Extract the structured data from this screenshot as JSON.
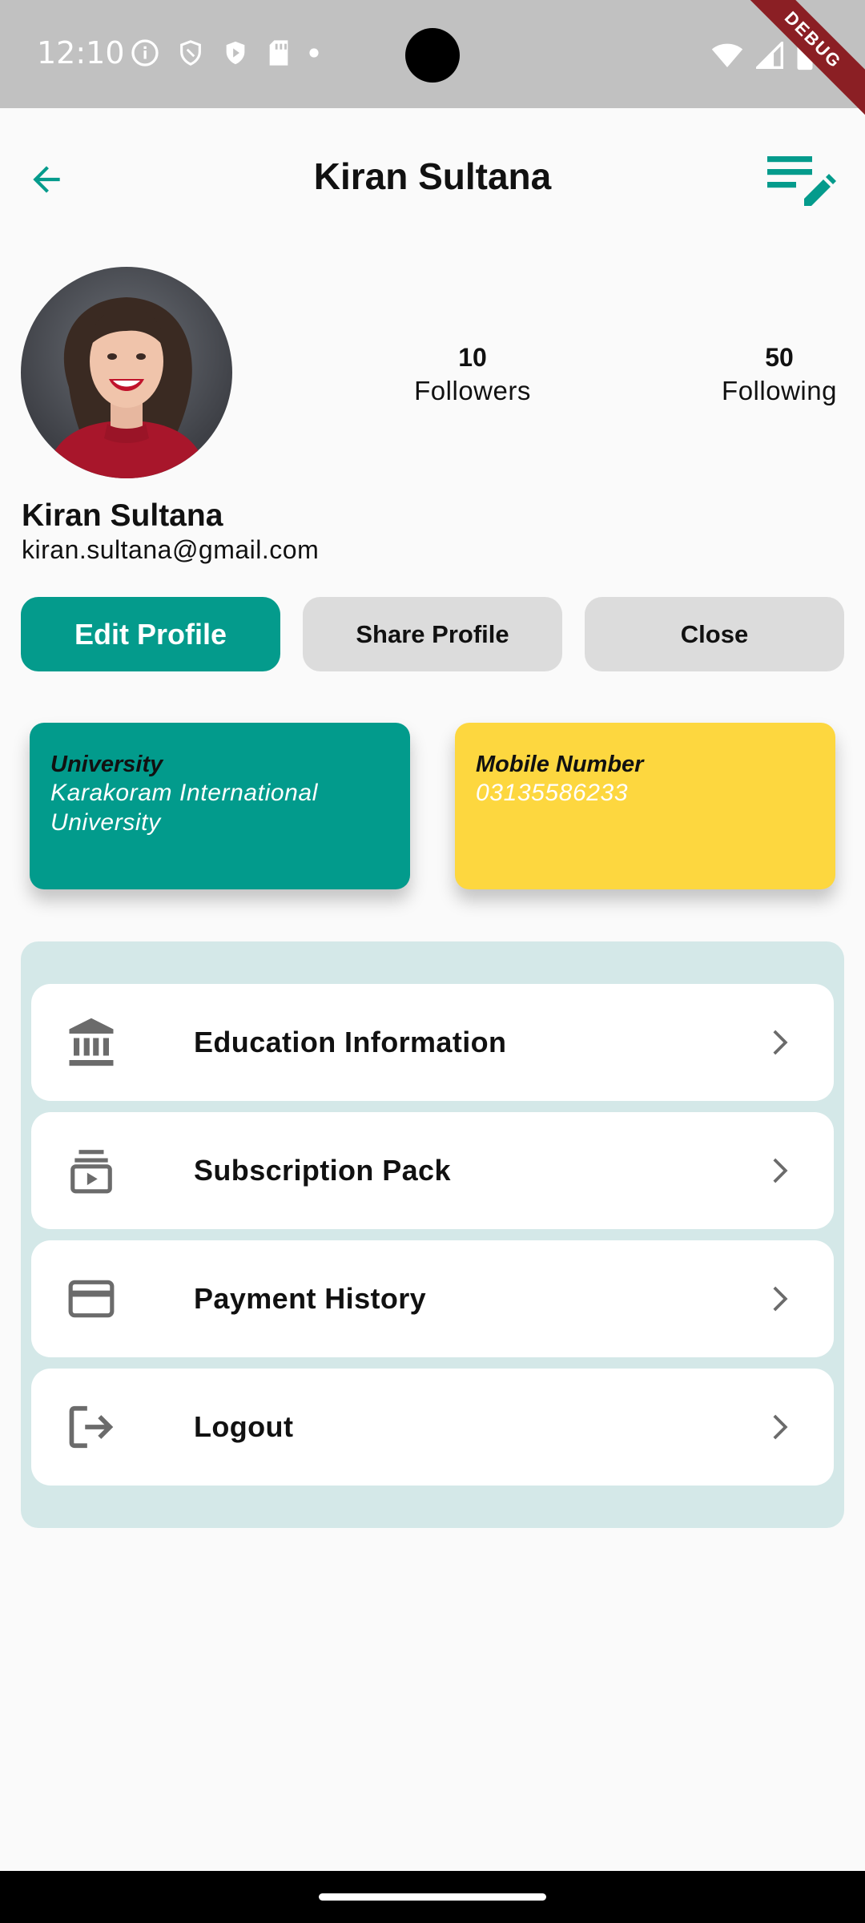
{
  "status_bar": {
    "time": "12:10",
    "debug_label": "DEBUG",
    "icons_left": [
      "info-icon",
      "shield-icon",
      "play-shield-icon",
      "sd-card-icon",
      "dot-icon"
    ],
    "icons_right": [
      "wifi-icon",
      "signal-icon",
      "battery-icon"
    ]
  },
  "app_bar": {
    "title": "Kiran Sultana",
    "back_icon": "arrow-back-icon",
    "action_icon": "edit-list-icon",
    "accent": "#049b8c"
  },
  "profile": {
    "name": "Kiran Sultana",
    "email": "kiran.sultana@gmail.com",
    "followers": {
      "count": "10",
      "label": "Followers"
    },
    "following": {
      "count": "50",
      "label": "Following"
    }
  },
  "actions": {
    "edit": "Edit Profile",
    "share": "Share Profile",
    "close": "Close"
  },
  "cards": {
    "university": {
      "title": "University",
      "value": "Karakoram International University",
      "color": "#029b8c"
    },
    "mobile": {
      "title": "Mobile Number",
      "value": "03135586233",
      "color": "#fdd73f"
    }
  },
  "menu": {
    "items": [
      {
        "label": "Education Information",
        "icon": "bank-icon"
      },
      {
        "label": "Subscription Pack",
        "icon": "subscriptions-icon"
      },
      {
        "label": "Payment History",
        "icon": "credit-card-icon"
      },
      {
        "label": "Logout",
        "icon": "logout-icon"
      }
    ]
  }
}
